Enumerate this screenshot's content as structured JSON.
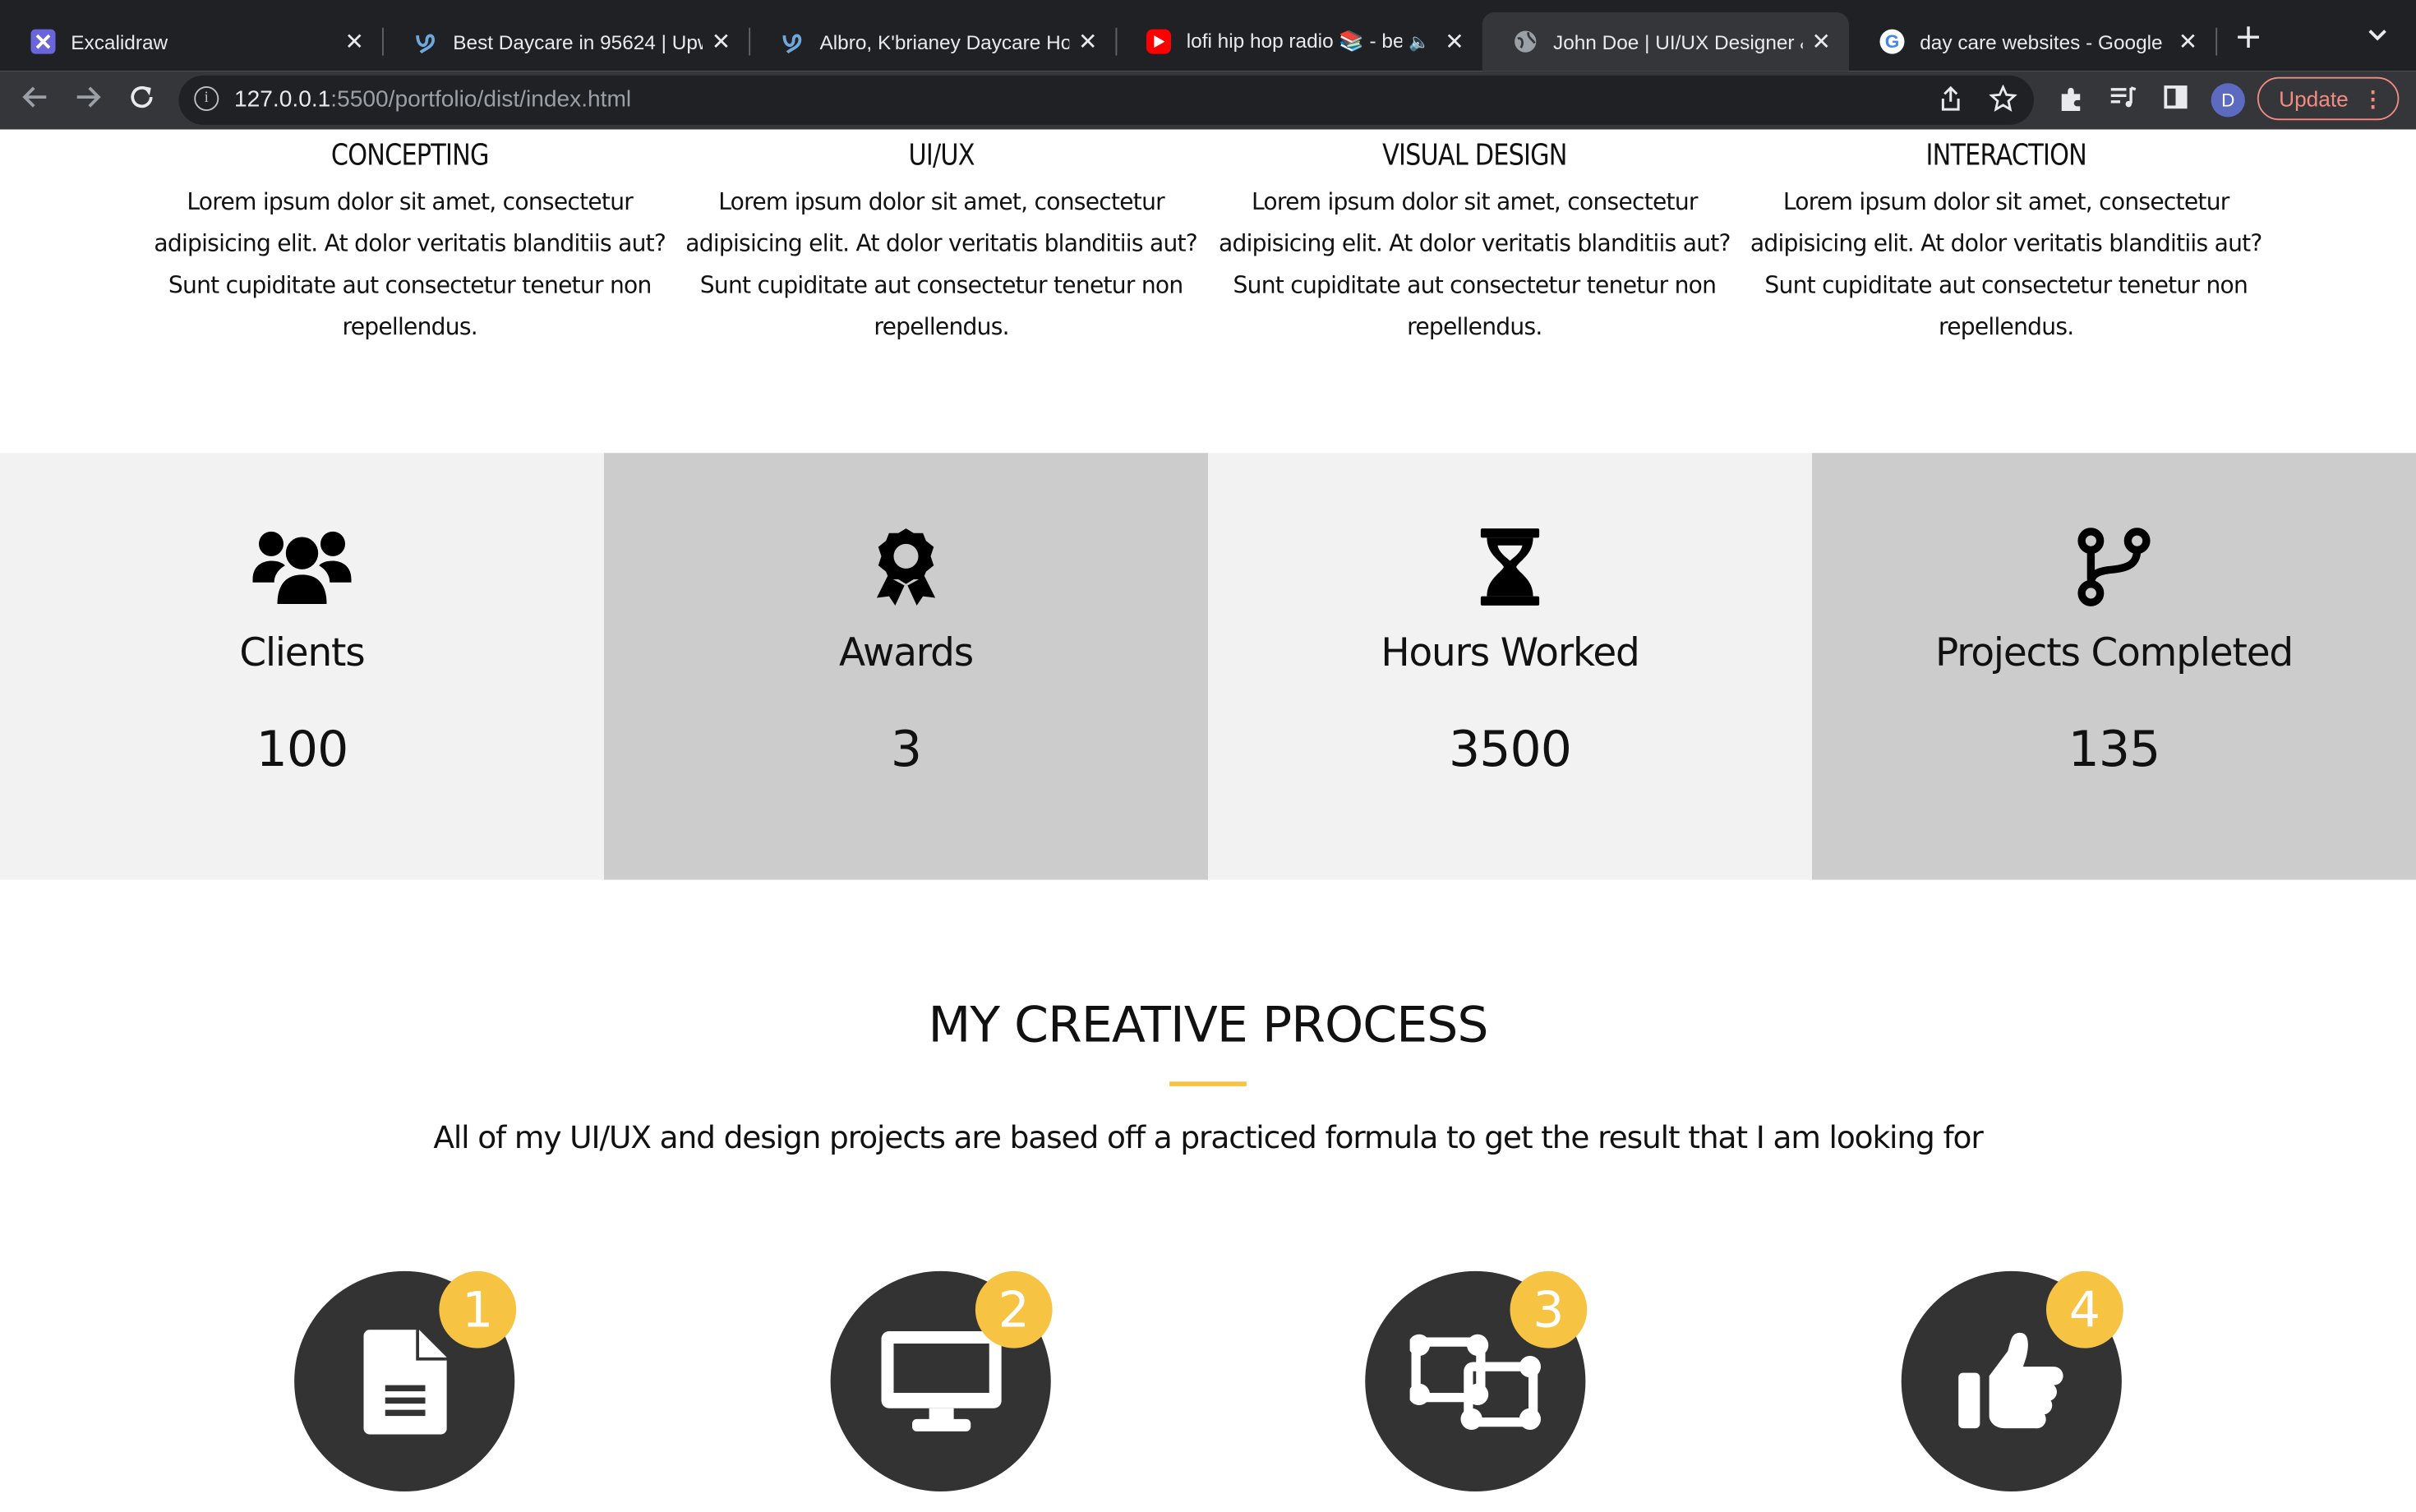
{
  "browser": {
    "tabs": [
      {
        "title": "Excalidraw",
        "icon": "excalidraw-icon",
        "active": false
      },
      {
        "title": "Best Daycare in 95624 | Upw",
        "icon": "upwork-icon",
        "active": false
      },
      {
        "title": "Albro, K'brianey Daycare Ho",
        "icon": "upwork-icon",
        "active": false
      },
      {
        "title": "lofi hip hop radio 📚 - be",
        "icon": "youtube-icon",
        "active": false
      },
      {
        "title": "John Doe | UI/UX Designer &",
        "icon": "globe-icon",
        "active": true
      },
      {
        "title": "day care websites - Google",
        "icon": "google-icon",
        "active": false
      }
    ],
    "url_host": "127.0.0.1",
    "url_path": ":5500/portfolio/dist/index.html",
    "profile_initial": "D",
    "update_label": "Update"
  },
  "services": [
    {
      "title": "CONCEPTING",
      "text": "Lorem ipsum dolor sit amet, consectetur adipisicing elit. At dolor veritatis blanditiis aut? Sunt cupiditate aut consectetur tenetur non repellendus."
    },
    {
      "title": "UI/UX",
      "text": "Lorem ipsum dolor sit amet, consectetur adipisicing elit. At dolor veritatis blanditiis aut? Sunt cupiditate aut consectetur tenetur non repellendus."
    },
    {
      "title": "VISUAL DESIGN",
      "text": "Lorem ipsum dolor sit amet, consectetur adipisicing elit. At dolor veritatis blanditiis aut? Sunt cupiditate aut consectetur tenetur non repellendus."
    },
    {
      "title": "INTERACTION",
      "text": "Lorem ipsum dolor sit amet, consectetur adipisicing elit. At dolor veritatis blanditiis aut? Sunt cupiditate aut consectetur tenetur non repellendus."
    }
  ],
  "stats": [
    {
      "label": "Clients",
      "value": "100",
      "icon": "users-icon"
    },
    {
      "label": "Awards",
      "value": "3",
      "icon": "award-icon"
    },
    {
      "label": "Hours Worked",
      "value": "3500",
      "icon": "hourglass-icon"
    },
    {
      "label": "Projects Completed",
      "value": "135",
      "icon": "code-branch-icon"
    }
  ],
  "process": {
    "title": "MY CREATIVE PROCESS",
    "subtitle": "All of my UI/UX and design projects are based off a practiced formula to get the result that I am looking for",
    "accent": "#f6c343",
    "steps": [
      {
        "number": "1",
        "icon": "file-icon"
      },
      {
        "number": "2",
        "icon": "desktop-icon"
      },
      {
        "number": "3",
        "icon": "object-group-icon"
      },
      {
        "number": "4",
        "icon": "thumbs-up-icon"
      }
    ]
  }
}
